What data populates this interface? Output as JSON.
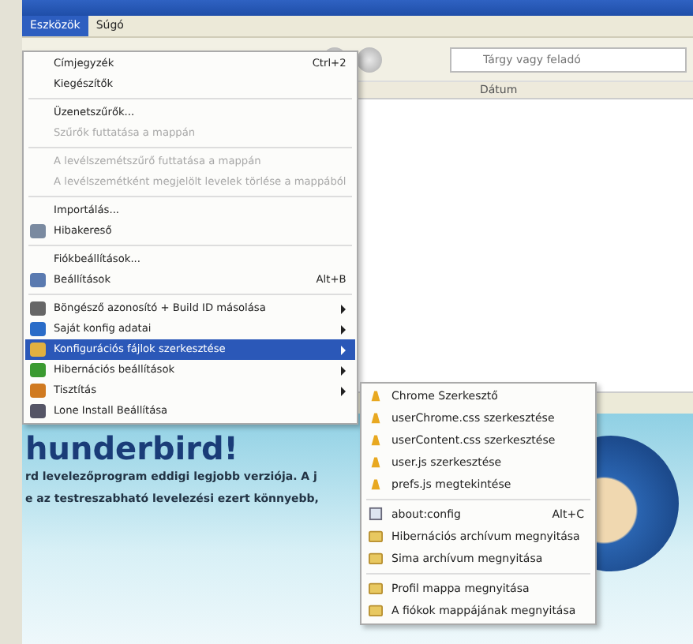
{
  "menubar": [
    {
      "label": "Eszközök",
      "selected": true
    },
    {
      "label": "Súgó",
      "selected": false
    }
  ],
  "search": {
    "placeholder": "Tárgy vagy feladó"
  },
  "columns": [
    "Dátum"
  ],
  "content": {
    "heading": "hunderbird!",
    "lines": [
      "rd levelezőprogram eddigi legjobb verziója. A j",
      "e az testreszabható levelezési ezert könnyebb,"
    ]
  },
  "menu": [
    {
      "kind": "item",
      "label": "Címjegyzék",
      "shortcut": "Ctrl+2",
      "disabled": false,
      "submenu": false,
      "selected": false
    },
    {
      "kind": "item",
      "label": "Kiegészítők",
      "disabled": false,
      "submenu": false,
      "selected": false
    },
    {
      "kind": "separator"
    },
    {
      "kind": "item",
      "label": "Üzenetszűrők...",
      "disabled": false,
      "submenu": false,
      "selected": false
    },
    {
      "kind": "item",
      "label": "Szűrők futtatása a mappán",
      "disabled": true,
      "submenu": false,
      "selected": false
    },
    {
      "kind": "separator"
    },
    {
      "kind": "item",
      "label": "A levélszemétszűrő futtatása a mappán",
      "disabled": true,
      "submenu": false,
      "selected": false
    },
    {
      "kind": "item",
      "label": "A levélszemétként megjelölt levelek törlése a mappából",
      "disabled": true,
      "submenu": false,
      "selected": false
    },
    {
      "kind": "separator"
    },
    {
      "kind": "item",
      "label": "Importálás...",
      "disabled": false,
      "submenu": false,
      "selected": false
    },
    {
      "kind": "item",
      "label": "Hibakereső",
      "disabled": false,
      "submenu": false,
      "selected": false
    },
    {
      "kind": "separator"
    },
    {
      "kind": "item",
      "label": "Fiókbeállítások...",
      "disabled": false,
      "submenu": false,
      "selected": false
    },
    {
      "kind": "item",
      "label": "Beállítások",
      "shortcut": "Alt+B",
      "disabled": false,
      "submenu": false,
      "selected": false
    },
    {
      "kind": "separator"
    },
    {
      "kind": "item",
      "label": "Böngésző azonosító + Build ID másolása",
      "disabled": false,
      "submenu": true,
      "selected": false
    },
    {
      "kind": "item",
      "label": "Saját konfig adatai",
      "disabled": false,
      "submenu": true,
      "selected": false
    },
    {
      "kind": "item",
      "label": "Konfigurációs fájlok szerkesztése",
      "disabled": false,
      "submenu": true,
      "selected": true
    },
    {
      "kind": "item",
      "label": "Hibernációs beállítások",
      "disabled": false,
      "submenu": true,
      "selected": false
    },
    {
      "kind": "item",
      "label": "Tisztítás",
      "disabled": false,
      "submenu": true,
      "selected": false
    },
    {
      "kind": "item",
      "label": "Lone Install Beállítása",
      "disabled": false,
      "submenu": false,
      "selected": false
    }
  ],
  "submenu": [
    {
      "kind": "file",
      "label": "Chrome Szerkesztő"
    },
    {
      "kind": "file",
      "label": "userChrome.css szerkesztése"
    },
    {
      "kind": "file",
      "label": "userContent.css szerkesztése"
    },
    {
      "kind": "file",
      "label": "user.js szerkesztése"
    },
    {
      "kind": "file",
      "label": "prefs.js megtekintése"
    },
    {
      "kind": "separator"
    },
    {
      "kind": "page",
      "label": "about:config",
      "shortcut": "Alt+C"
    },
    {
      "kind": "folder",
      "label": "Hibernációs archívum megnyitása"
    },
    {
      "kind": "folder",
      "label": "Sima archívum megnyitása"
    },
    {
      "kind": "separator"
    },
    {
      "kind": "folder",
      "label": "Profil mappa megnyitása"
    },
    {
      "kind": "folder",
      "label": "A fiókok mappájának megnyitása"
    }
  ]
}
